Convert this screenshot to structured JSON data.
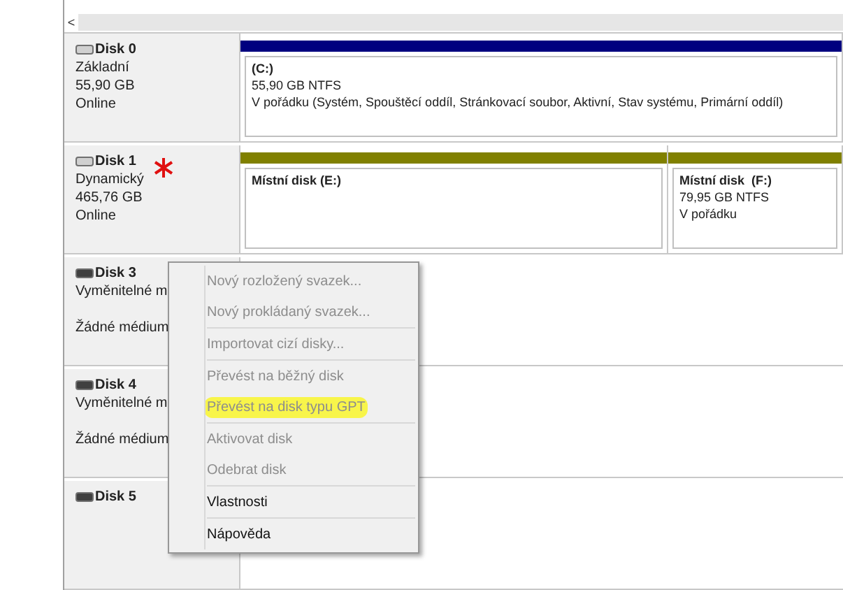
{
  "scrollbar": {
    "left_arrow": "<"
  },
  "disks": [
    {
      "name": "Disk 0",
      "kind": "fixed",
      "lines": [
        "Základní",
        "55,90 GB",
        "Online"
      ],
      "annotated": false,
      "partitions": [
        {
          "title": "(C:)",
          "lines": [
            "55,90 GB NTFS",
            "V pořádku (Systém, Spouštěcí oddíl, Stránkovací soubor, Aktivní, Stav systému, Primární oddíl)"
          ],
          "color": "#00007f"
        }
      ]
    },
    {
      "name": "Disk 1",
      "kind": "fixed",
      "lines": [
        "Dynamický",
        "465,76 GB",
        "Online"
      ],
      "annotated": true,
      "partitions": [
        {
          "title": "Místní disk (E:)",
          "color": "#808000"
        },
        {
          "title": "Místní disk  (F:)",
          "lines": [
            "79,95 GB NTFS",
            "V pořádku"
          ],
          "color": "#808000"
        }
      ]
    },
    {
      "name": "Disk 3",
      "kind": "removable",
      "lines": [
        "Vyměnitelné m"
      ],
      "status": "Žádné médium",
      "annotated": false
    },
    {
      "name": "Disk 4",
      "kind": "removable",
      "lines": [
        "Vyměnitelné m"
      ],
      "status": "Žádné médium",
      "annotated": false
    },
    {
      "name": "Disk 5",
      "kind": "removable",
      "annotated": false
    }
  ],
  "context_menu": {
    "groups": [
      [
        {
          "label": "Nový rozložený svazek...",
          "disabled": true,
          "highlighted": false
        },
        {
          "label": "Nový prokládaný svazek...",
          "disabled": true,
          "highlighted": false
        }
      ],
      [
        {
          "label": "Importovat cizí disky...",
          "disabled": true,
          "highlighted": false
        }
      ],
      [
        {
          "label": "Převést na běžný disk",
          "disabled": true,
          "highlighted": false
        },
        {
          "label": "Převést na disk typu GPT",
          "disabled": true,
          "highlighted": true
        }
      ],
      [
        {
          "label": "Aktivovat disk",
          "disabled": true,
          "highlighted": false
        },
        {
          "label": "Odebrat disk",
          "disabled": true,
          "highlighted": false
        }
      ],
      [
        {
          "label": "Vlastnosti",
          "disabled": false,
          "highlighted": false
        }
      ],
      [
        {
          "label": "Nápověda",
          "disabled": false,
          "highlighted": false
        }
      ]
    ]
  }
}
